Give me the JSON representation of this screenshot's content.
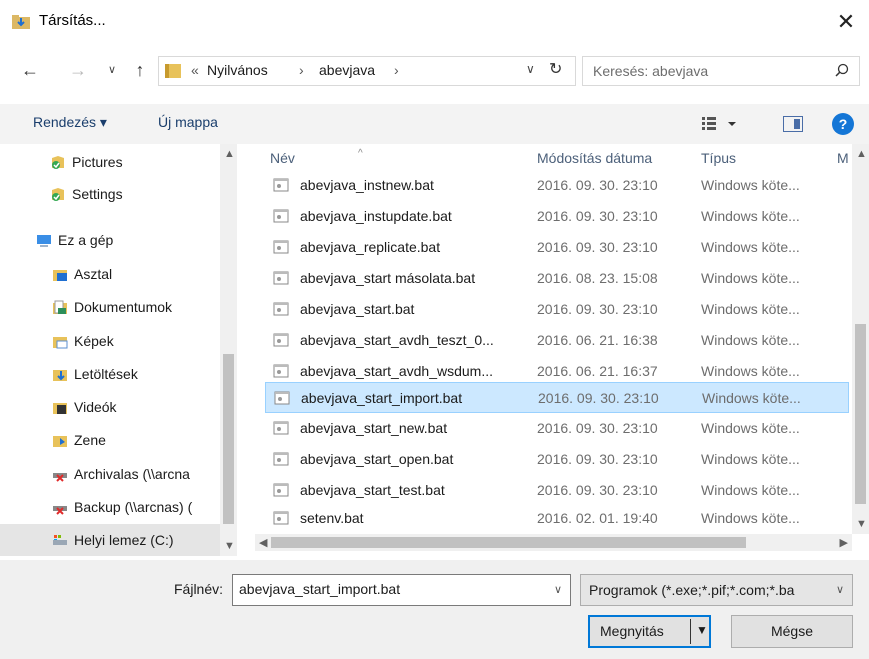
{
  "window": {
    "title": "Társítás..."
  },
  "address": {
    "breadcrumbs": [
      "Nyilvános",
      "abevjava"
    ],
    "search_placeholder": "Keresés: abevjava"
  },
  "toolbar": {
    "organize_label": "Rendezés ▾",
    "new_folder_label": "Új mappa"
  },
  "nav_pane": {
    "items": [
      {
        "label": "Pictures",
        "icon": "pictures-icon"
      },
      {
        "label": "Settings",
        "icon": "settings-icon"
      },
      {
        "label": "Ez a gép",
        "icon": "computer-icon"
      },
      {
        "label": "Asztal",
        "icon": "desktop-folder-icon"
      },
      {
        "label": "Dokumentumok",
        "icon": "documents-folder-icon"
      },
      {
        "label": "Képek",
        "icon": "pictures-folder-icon"
      },
      {
        "label": "Letöltések",
        "icon": "downloads-folder-icon"
      },
      {
        "label": "Videók",
        "icon": "videos-folder-icon"
      },
      {
        "label": "Zene",
        "icon": "music-folder-icon"
      },
      {
        "label": "Archivalas (\\\\arcna",
        "icon": "network-drive-disconnected-icon"
      },
      {
        "label": "Backup (\\\\arcnas) (",
        "icon": "network-drive-disconnected-icon"
      },
      {
        "label": "Helyi lemez (C:)",
        "icon": "local-disk-icon"
      }
    ]
  },
  "file_list": {
    "columns": {
      "name": "Név",
      "modified": "Módosítás dátuma",
      "type": "Típus",
      "size": "M"
    },
    "rows": [
      {
        "name": "abevjava_instnew.bat",
        "modified": "2016. 09. 30. 23:10",
        "type": "Windows köte..."
      },
      {
        "name": "abevjava_instupdate.bat",
        "modified": "2016. 09. 30. 23:10",
        "type": "Windows köte..."
      },
      {
        "name": "abevjava_replicate.bat",
        "modified": "2016. 09. 30. 23:10",
        "type": "Windows köte..."
      },
      {
        "name": "abevjava_start másolata.bat",
        "modified": "2016. 08. 23. 15:08",
        "type": "Windows köte..."
      },
      {
        "name": "abevjava_start.bat",
        "modified": "2016. 09. 30. 23:10",
        "type": "Windows köte..."
      },
      {
        "name": "abevjava_start_avdh_teszt_0...",
        "modified": "2016. 06. 21. 16:38",
        "type": "Windows köte..."
      },
      {
        "name": "abevjava_start_avdh_wsdum...",
        "modified": "2016. 06. 21. 16:37",
        "type": "Windows köte..."
      },
      {
        "name": "abevjava_start_import.bat",
        "modified": "2016. 09. 30. 23:10",
        "type": "Windows köte...",
        "selected": true
      },
      {
        "name": "abevjava_start_new.bat",
        "modified": "2016. 09. 30. 23:10",
        "type": "Windows köte..."
      },
      {
        "name": "abevjava_start_open.bat",
        "modified": "2016. 09. 30. 23:10",
        "type": "Windows köte..."
      },
      {
        "name": "abevjava_start_test.bat",
        "modified": "2016. 09. 30. 23:10",
        "type": "Windows köte..."
      },
      {
        "name": "setenv.bat",
        "modified": "2016. 02. 01. 19:40",
        "type": "Windows köte..."
      }
    ]
  },
  "bottom": {
    "filename_label": "Fájlnév:",
    "filename_value": "abevjava_start_import.bat",
    "filter_value": "Programok (*.exe;*.pif;*.com;*.ba",
    "open_label": "Megnyitás",
    "cancel_label": "Mégse"
  },
  "colors": {
    "selection_bg": "#cce8ff",
    "selection_border": "#99d1ff",
    "accent": "#0078d7",
    "help": "#1476d6"
  }
}
